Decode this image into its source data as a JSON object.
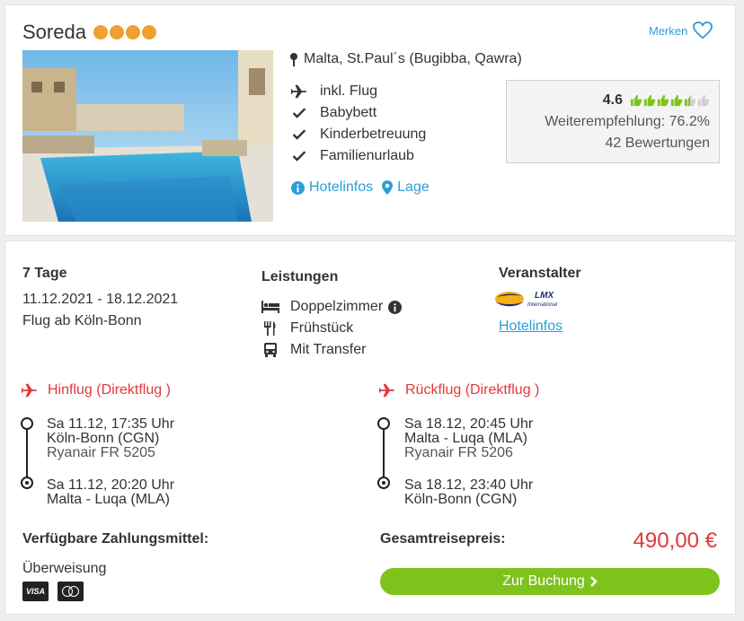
{
  "hotel": {
    "name": "Soreda",
    "star_count": 4,
    "merken_label": "Merken",
    "location": "Malta, St.Paul´s (Bugibba, Qawra)",
    "features": [
      "inkl. Flug",
      "Babybett",
      "Kinderbetreuung",
      "Familienurlaub"
    ],
    "link_hotelinfos": "Hotelinfos",
    "link_lage": "Lage"
  },
  "rating": {
    "score": "4.6",
    "thumbs_full": 4,
    "thumbs_half": 1,
    "thumbs_total": 6,
    "recommendation": "Weiterempfehlung: 76.2%",
    "reviews": "42 Bewertungen"
  },
  "offer": {
    "duration": "7 Tage",
    "dates": "11.12.2021 - 18.12.2021",
    "departure": "Flug ab Köln-Bonn",
    "services_title": "Leistungen",
    "services": [
      "Doppelzimmer",
      "Frühstück",
      "Mit Transfer"
    ],
    "operator_title": "Veranstalter",
    "operator_logo": "LMX",
    "operator_logo_sub": "International",
    "operator_link": "Hotelinfos"
  },
  "outbound": {
    "title": "Hinflug (Direktflug )",
    "dep_time": "Sa 11.12, 17:35 Uhr",
    "dep_airport": "Köln-Bonn (CGN)",
    "flight": "Ryanair FR 5205",
    "arr_time": "Sa 11.12, 20:20 Uhr",
    "arr_airport": "Malta - Luqa (MLA)"
  },
  "return": {
    "title": "Rückflug (Direktflug )",
    "dep_time": "Sa 18.12, 20:45 Uhr",
    "dep_airport": "Malta - Luqa (MLA)",
    "flight": "Ryanair FR 5206",
    "arr_time": "Sa 18.12, 23:40 Uhr",
    "arr_airport": "Köln-Bonn (CGN)"
  },
  "payment": {
    "title": "Verfügbare Zahlungsmittel:",
    "method": "Überweisung",
    "card_visa": "VISA"
  },
  "total": {
    "label": "Gesamtreisepreis:",
    "price": "490,00 €",
    "button": "Zur Buchung"
  },
  "colors": {
    "accent_blue": "#2b9fd6",
    "star_orange": "#f0a030",
    "thumb_green": "#7dc31c",
    "flight_red": "#e3383a",
    "button_green": "#7dc31c"
  }
}
